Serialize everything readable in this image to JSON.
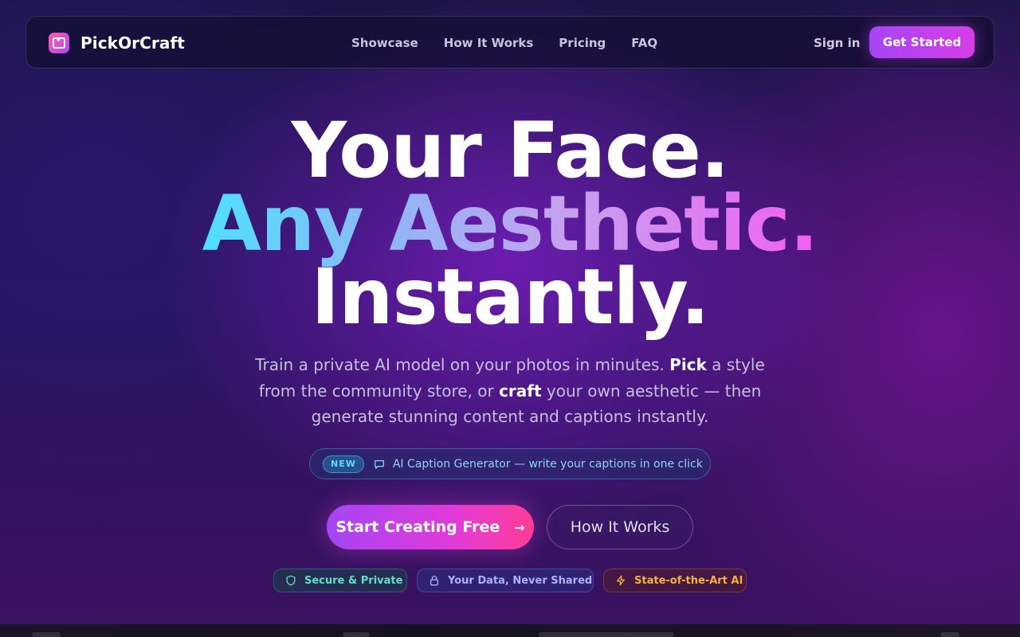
{
  "brand": {
    "name": "PickOrCraft",
    "logo_icon": "sparkle-image-icon"
  },
  "nav": {
    "links": [
      "Showcase",
      "How It Works",
      "Pricing",
      "FAQ"
    ],
    "signin": "Sign in",
    "cta": "Get Started"
  },
  "hero": {
    "line1": "Your Face.",
    "line2": "Any Aesthetic.",
    "line3": "Instantly.",
    "sub_a": "Train a private AI model on your photos in minutes. ",
    "sub_pick": "Pick",
    "sub_b": " a style from the community store, or ",
    "sub_craft": "craft",
    "sub_c": " your own aesthetic — then generate stunning content and captions instantly."
  },
  "announcement": {
    "badge": "NEW",
    "text": "AI Caption Generator — write your captions in one click",
    "icon": "chat-bubble-icon"
  },
  "buttons": {
    "primary": "Start Creating Free",
    "primary_icon": "arrow-right-icon",
    "secondary": "How It Works"
  },
  "trust_badges": [
    {
      "label": "Secure & Private",
      "icon": "shield-icon",
      "color": "#5fe0bf"
    },
    {
      "label": "Your Data, Never Shared",
      "icon": "lock-icon",
      "color": "#a8b3ff"
    },
    {
      "label": "State-of-the-Art AI",
      "icon": "lightning-icon",
      "color": "#f5b23a"
    }
  ],
  "colors": {
    "accent_purple": "#a645f6",
    "accent_pink": "#e13bd9",
    "accent_cyan": "#4ee0ff"
  }
}
